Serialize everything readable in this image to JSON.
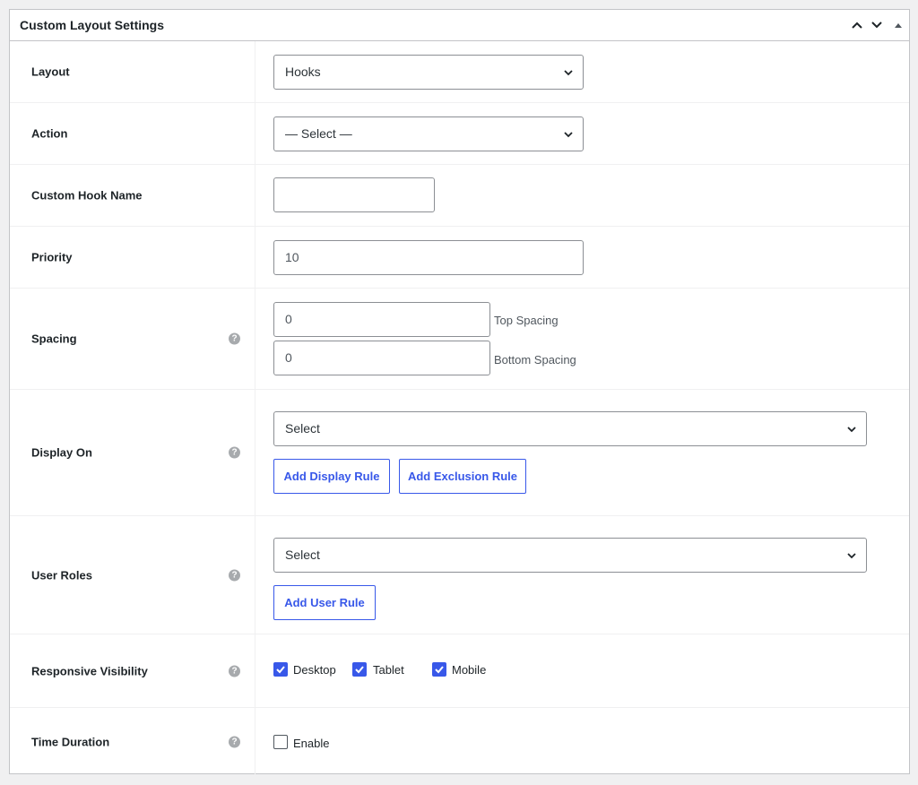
{
  "panel": {
    "title": "Custom Layout Settings"
  },
  "fields": {
    "layout": {
      "label": "Layout",
      "value": "Hooks"
    },
    "action": {
      "label": "Action",
      "value": "— Select —"
    },
    "custom_hook_name": {
      "label": "Custom Hook Name",
      "value": ""
    },
    "priority": {
      "label": "Priority",
      "value": "10"
    },
    "spacing": {
      "label": "Spacing",
      "top_value": "0",
      "top_note": "Top Spacing",
      "bottom_value": "0",
      "bottom_note": "Bottom Spacing"
    },
    "display_on": {
      "label": "Display On",
      "value": "Select",
      "add_display_rule": "Add Display Rule",
      "add_exclusion_rule": "Add Exclusion Rule"
    },
    "user_roles": {
      "label": "User Roles",
      "value": "Select",
      "add_user_rule": "Add User Rule"
    },
    "responsive_visibility": {
      "label": "Responsive Visibility",
      "options": [
        {
          "label": "Desktop",
          "checked": true
        },
        {
          "label": "Tablet",
          "checked": true
        },
        {
          "label": "Mobile",
          "checked": true
        }
      ]
    },
    "time_duration": {
      "label": "Time Duration",
      "enable_label": "Enable",
      "enabled": false
    }
  },
  "colors": {
    "accent": "#3858e9",
    "border": "#8c8f94",
    "help_icon": "#a7aaad"
  },
  "help_icon_glyph": "?"
}
